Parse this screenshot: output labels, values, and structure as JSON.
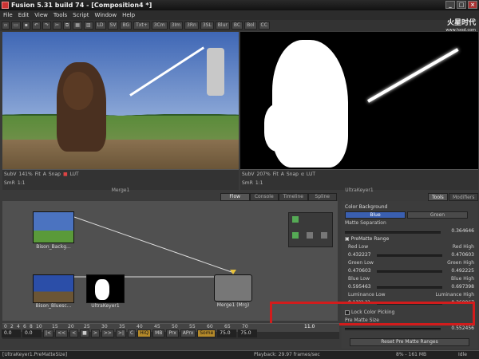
{
  "window": {
    "title": "Fusion 5.31 build 74 - [Composition4 *]",
    "min": "_",
    "max": "□",
    "close": "×"
  },
  "menu": [
    "File",
    "Edit",
    "View",
    "Tools",
    "Script",
    "Window",
    "Help"
  ],
  "toolbar": {
    "buttons": [
      "LD",
      "SV",
      "BG",
      "Txt+",
      "3Cm",
      "3Im",
      "3Rn",
      "3SL",
      "Blur",
      "BC",
      "Bol",
      "CC"
    ]
  },
  "logo": {
    "text": "火星时代",
    "sub": "www.hxsd.com"
  },
  "viewers": {
    "left": {
      "subv": "SubV",
      "zoom": "141%",
      "fit": "Fit",
      "snap": "Snap",
      "lut": "LUT",
      "smr": "SmR",
      "ratio": "1:1",
      "node_name": "Merge1"
    },
    "right": {
      "subv": "SubV",
      "zoom": "207%",
      "fit": "Fit",
      "snap": "Snap",
      "lut": "LUT",
      "smr": "SmR",
      "ratio": "1:1",
      "node_name": "UltraKeyer1"
    }
  },
  "flow_tabs": [
    "Flow",
    "Console",
    "Timeline",
    "Spline"
  ],
  "flow_nodes": {
    "background": "Bison_Backg...",
    "bluescreen": "Bison_Bluesc...",
    "keyer": "UltraKeyer1",
    "merge": "Merge1 (Mrg)"
  },
  "panel_tabs": [
    "Tools",
    "Modifiers"
  ],
  "panel": {
    "color_background_label": "Color Background",
    "blue": "Blue",
    "green": "Green",
    "matte_separation_label": "Matte Separation",
    "matte_separation_value": "0.364646",
    "prematte_range_label": "PreMatte Range",
    "red_low_label": "Red Low",
    "red_low": "0.432227",
    "red_high_label": "Red High",
    "red_high": "0.470603",
    "green_low_label": "Green Low",
    "green_low": "0.470603",
    "green_high_label": "Green High",
    "green_high": "0.492225",
    "blue_low_label": "Blue Low",
    "blue_low": "0.595463",
    "blue_high_label": "Blue High",
    "blue_high": "0.697398",
    "luminance_low_label": "Luminance Low",
    "luminance_low": "0.1??? ??",
    "luminance_high_label": "Luminance High",
    "luminance_high": "0.360067",
    "lock_color_picking": "Lock Color Picking",
    "prematte_size_label": "Pre Matte Size",
    "prematte_size_value": "0.552456",
    "reset_button": "Reset Pre Matte Ranges"
  },
  "timeline": {
    "ticks": [
      "0",
      "2",
      "4",
      "6",
      "8",
      "10",
      "15",
      "20",
      "25",
      "30",
      "35",
      "40",
      "45",
      "50",
      "55",
      "60",
      "65",
      "70"
    ],
    "current_frame": "11.0"
  },
  "transport": {
    "start": "0.0",
    "current": "0.0",
    "buttons": [
      "|<",
      "<<",
      "<",
      "■",
      ">",
      ">>",
      ">|"
    ],
    "loop": "C",
    "hiq": "HiQ",
    "mb": "MB",
    "prx": "Prx",
    "aprx": "APrx",
    "some": "Some",
    "end_a": "75.0",
    "end_b": "75.0"
  },
  "status": {
    "left": "[UltraKeyer1.PreMatteSize]",
    "playback": "Playback: 29.97 frames/sec",
    "memory": "8% - 161 MB",
    "state": "Idle"
  },
  "colors": {
    "highlight_box": "#d21c1c",
    "accent": "#b58a2a"
  }
}
